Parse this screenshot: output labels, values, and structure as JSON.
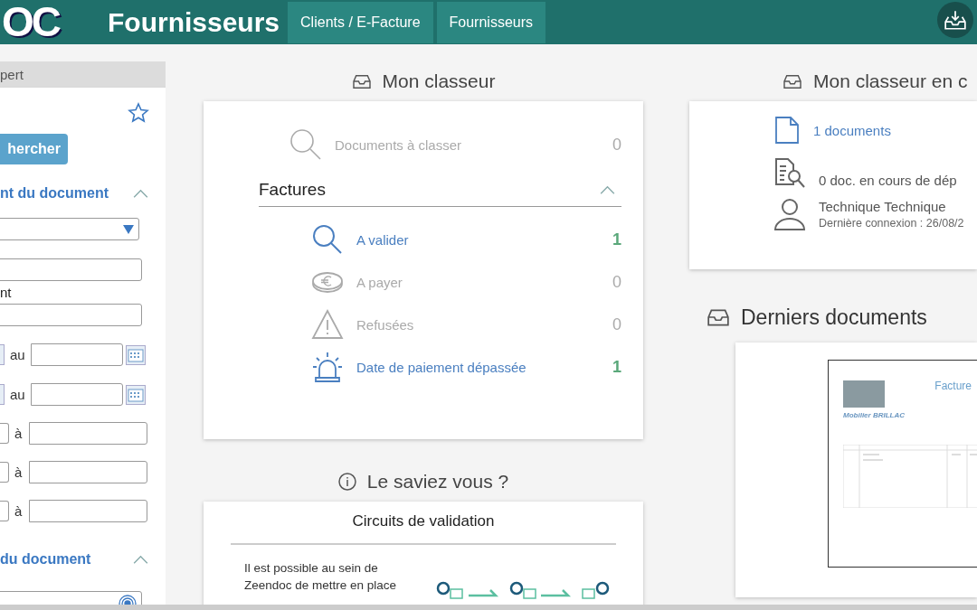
{
  "header": {
    "logo": "OC",
    "title": "Fournisseurs",
    "tabs": [
      {
        "label": "Clients / E-Facture"
      },
      {
        "label": "Fournisseurs"
      }
    ]
  },
  "sidebar": {
    "top_label": "pert",
    "items": [
      {
        "kind": "star"
      },
      {
        "kind": "button",
        "label": "hercher"
      },
      {
        "kind": "section",
        "label": "nt du document"
      },
      {
        "kind": "select"
      },
      {
        "kind": "input"
      },
      {
        "kind": "label",
        "label": "nt"
      },
      {
        "kind": "input"
      },
      {
        "kind": "date_range",
        "label": "au"
      },
      {
        "kind": "date_range",
        "label": "au"
      },
      {
        "kind": "range",
        "label": "à"
      },
      {
        "kind": "range",
        "label": "à"
      },
      {
        "kind": "range",
        "label": "à"
      },
      {
        "kind": "section",
        "label": "du document"
      },
      {
        "kind": "picker"
      }
    ]
  },
  "classeur": {
    "title": "Mon classeur",
    "pending": {
      "label": "Documents à classer",
      "count": "0"
    },
    "group": {
      "title": "Factures",
      "expanded": true
    },
    "rows": [
      {
        "kind": "validate",
        "label": "A valider",
        "count": "1",
        "active": true
      },
      {
        "kind": "pay",
        "label": "A payer",
        "count": "0",
        "active": false
      },
      {
        "kind": "refused",
        "label": "Refusées",
        "count": "0",
        "active": false
      },
      {
        "kind": "overdue",
        "label": "Date de paiement dépassée",
        "count": "1",
        "active": true
      }
    ]
  },
  "tip": {
    "title": "Le saviez vous ?",
    "card_title": "Circuits de validation",
    "text": "Il est possible au sein de Zeendoc de mettre en place"
  },
  "classeur_courant": {
    "title": "Mon classeur en c",
    "documents": "1 documents",
    "in_progress": "0 doc. en cours de dép",
    "user": "Technique Technique",
    "last_login": "Dernière connexion : 26/08/2"
  },
  "derniers": {
    "title": "Derniers documents",
    "preview": {
      "heading": "Facture",
      "company": "Mobilier BRILLAC"
    }
  }
}
